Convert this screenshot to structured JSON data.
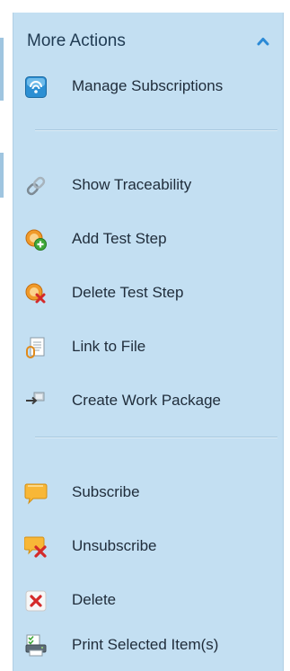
{
  "panel": {
    "title": "More Actions",
    "collapse_icon": "chevron-up-icon",
    "colors": {
      "background": "#c3dff2",
      "accent": "#2b8ad6",
      "text": "#1f2c3a"
    }
  },
  "items": [
    {
      "label": "Manage Subscriptions",
      "icon": "subscriptions-icon"
    },
    {
      "label": "Show Traceability",
      "icon": "link-chain-icon"
    },
    {
      "label": "Add Test Step",
      "icon": "add-step-icon"
    },
    {
      "label": "Delete Test Step",
      "icon": "delete-step-icon"
    },
    {
      "label": "Link to File",
      "icon": "link-file-icon"
    },
    {
      "label": "Create Work Package",
      "icon": "work-package-icon"
    },
    {
      "label": "Subscribe",
      "icon": "speech-bubble-icon"
    },
    {
      "label": "Unsubscribe",
      "icon": "unsubscribe-icon"
    },
    {
      "label": "Delete",
      "icon": "red-x-icon"
    },
    {
      "label": "Print Selected Item(s)",
      "icon": "print-list-icon"
    }
  ]
}
